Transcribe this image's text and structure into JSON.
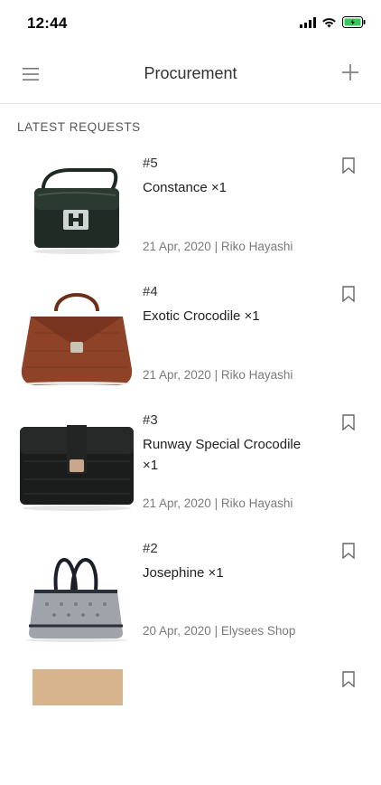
{
  "status_bar": {
    "time": "12:44"
  },
  "nav": {
    "title": "Procurement",
    "left_icon": "hamburger-menu-icon",
    "right_icon": "plus-icon"
  },
  "section": {
    "header": "LATEST REQUESTS"
  },
  "requests": [
    {
      "number": "#5",
      "name": "Constance ×1",
      "meta": "21 Apr, 2020 | Riko Hayashi"
    },
    {
      "number": "#4",
      "name": "Exotic Crocodile ×1",
      "meta": "21 Apr, 2020 | Riko Hayashi"
    },
    {
      "number": "#3",
      "name": "Runway Special Crocodile ×1",
      "meta": "21 Apr, 2020 | Riko Hayashi"
    },
    {
      "number": "#2",
      "name": "Josephine ×1",
      "meta": "20 Apr, 2020 | Elysees Shop"
    }
  ],
  "colors": {
    "battery": "#34c759",
    "divider": "#e6e6e6",
    "meta_text": "#7a7a7a"
  }
}
